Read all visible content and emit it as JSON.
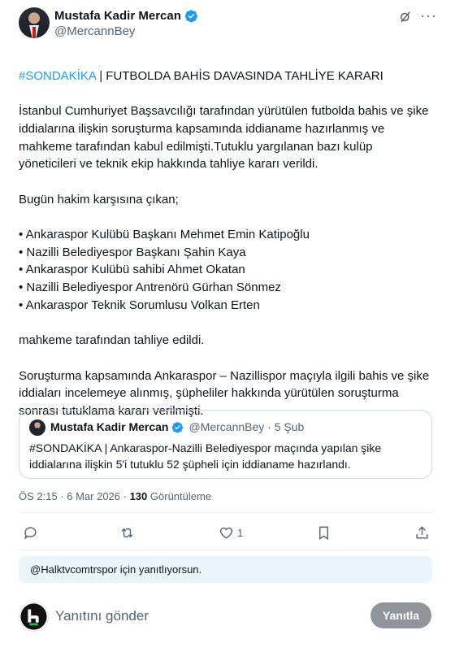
{
  "author": {
    "name": "Mustafa Kadir Mercan",
    "handle": "@MercannBey"
  },
  "post": {
    "hashtag": "#SONDAKİKA",
    "headline": " | FUTBOLDA BAHİS DAVASINDA TAHLİYE KARARI",
    "paragraph1": "İstanbul Cumhuriyet Başsavcılığı tarafından yürütülen futbolda bahis ve şike iddialarına ilişkin soruşturma kapsamında iddianame hazırlanmış ve mahkeme tarafından kabul edilmişti.Tutuklu yargılanan bazı kulüp yöneticileri ve teknik ekip hakkında tahliye kararı verildi.",
    "intro": "Bugün hakim karşısına çıkan;",
    "bullets": [
      "• Ankaraspor Kulübü Başkanı Mehmet Emin Katipoğlu",
      "• Nazilli Belediyespor Başkanı Şahin Kaya",
      "• Ankaraspor Kulübü sahibi Ahmet Okatan",
      "• Nazilli Belediyespor Antrenörü Gürhan Sönmez",
      "• Ankaraspor Teknik Sorumlusu Volkan Erten"
    ],
    "outcome": "mahkeme tarafından tahliye edildi.",
    "paragraph2": "Soruşturma kapsamında Ankaraspor – Nazillispor maçıyla ilgili bahis ve şike iddiaları incelemeye alınmış, şüpheliler hakkında yürütülen soruşturma sonrası tutuklama kararı verilmişti."
  },
  "quote": {
    "name": "Mustafa Kadir Mercan",
    "meta": "@MercannBey · 5 Şub",
    "text": "#SONDAKİKA | Ankaraspor-Nazilli Belediyespor maçında yapılan şike iddialarına ilişkin 5'i tutuklu 52 şüpheli için iddianame hazırlandı."
  },
  "meta": {
    "time": "ÖS 2:15 · 6 Mar 2026 · ",
    "views_count": "130",
    "views_label": " Görüntüleme"
  },
  "actions": {
    "likes": "1"
  },
  "reply": {
    "replying_to": "@Halktvcomtrspor için yanıtlıyorsun.",
    "placeholder": "Yanıtını gönder",
    "button": "Yanıtla"
  },
  "colors": {
    "accent": "#1d9bf0",
    "muted": "#536471",
    "reply_button": "#8f959a",
    "replying_bg": "#eaf4fb"
  }
}
